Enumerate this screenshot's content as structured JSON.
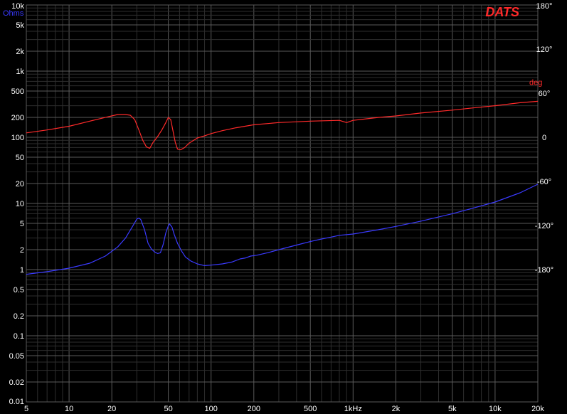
{
  "chart_data": {
    "type": "line",
    "logo": "DATS",
    "colors": {
      "background": "#000000",
      "grid_major": "#5a5a5a",
      "grid_minor": "#2e2e2e",
      "impedance": "#3a3aff",
      "phase": "#ff2a2a",
      "ohms_label": "#3a3aff",
      "deg_label": "#ff2a2a",
      "tick_text": "#ffffff"
    },
    "x_axis": {
      "scale": "log",
      "range": [
        5,
        20000
      ],
      "ticks": [
        {
          "value": 5,
          "label": "5"
        },
        {
          "value": 10,
          "label": "10"
        },
        {
          "value": 20,
          "label": "20"
        },
        {
          "value": 50,
          "label": "50"
        },
        {
          "value": 100,
          "label": "100"
        },
        {
          "value": 200,
          "label": "200"
        },
        {
          "value": 500,
          "label": "500"
        },
        {
          "value": 1000,
          "label": "1kHz"
        },
        {
          "value": 2000,
          "label": "2k"
        },
        {
          "value": 5000,
          "label": "5k"
        },
        {
          "value": 10000,
          "label": "10k"
        },
        {
          "value": 20000,
          "label": "20k"
        }
      ]
    },
    "y_left": {
      "scale": "log",
      "unit": "Ohms",
      "range": [
        0.01,
        10000
      ],
      "ticks": [
        {
          "value": 10000,
          "label": "10k"
        },
        {
          "value": 5000,
          "label": "5k"
        },
        {
          "value": 2000,
          "label": "2k"
        },
        {
          "value": 1000,
          "label": "1k"
        },
        {
          "value": 500,
          "label": "500"
        },
        {
          "value": 200,
          "label": "200"
        },
        {
          "value": 100,
          "label": "100"
        },
        {
          "value": 50,
          "label": "50"
        },
        {
          "value": 20,
          "label": "20"
        },
        {
          "value": 10,
          "label": "10"
        },
        {
          "value": 5,
          "label": "5"
        },
        {
          "value": 2,
          "label": "2"
        },
        {
          "value": 1,
          "label": "1"
        },
        {
          "value": 0.5,
          "label": "0.5"
        },
        {
          "value": 0.2,
          "label": "0.2"
        },
        {
          "value": 0.1,
          "label": "0.1"
        },
        {
          "value": 0.05,
          "label": "0.05"
        },
        {
          "value": 0.02,
          "label": "0.02"
        },
        {
          "value": 0.01,
          "label": "0.01"
        }
      ]
    },
    "y_right": {
      "scale": "linear",
      "unit": "deg",
      "range": [
        -360,
        180
      ],
      "ticks": [
        {
          "value": 180,
          "label": "180°"
        },
        {
          "value": 120,
          "label": "120°"
        },
        {
          "value": 60,
          "label": "60°"
        },
        {
          "value": 0,
          "label": "0"
        },
        {
          "value": -60,
          "label": "-60°"
        },
        {
          "value": -120,
          "label": "-120°"
        },
        {
          "value": -180,
          "label": "-180°"
        }
      ]
    },
    "series": [
      {
        "axis": "left",
        "color": "#3a3aff",
        "points": [
          [
            5,
            0.85
          ],
          [
            7,
            0.93
          ],
          [
            10,
            1.05
          ],
          [
            14,
            1.25
          ],
          [
            18,
            1.6
          ],
          [
            22,
            2.2
          ],
          [
            25,
            3.0
          ],
          [
            28,
            4.5
          ],
          [
            30,
            5.8
          ],
          [
            31,
            6.0
          ],
          [
            32,
            5.7
          ],
          [
            34,
            4.0
          ],
          [
            36,
            2.5
          ],
          [
            38,
            2.05
          ],
          [
            40,
            1.85
          ],
          [
            42,
            1.75
          ],
          [
            44,
            1.8
          ],
          [
            46,
            2.4
          ],
          [
            48,
            3.6
          ],
          [
            50,
            4.6
          ],
          [
            51,
            4.9
          ],
          [
            53,
            4.4
          ],
          [
            55,
            3.4
          ],
          [
            58,
            2.5
          ],
          [
            62,
            1.9
          ],
          [
            66,
            1.55
          ],
          [
            72,
            1.35
          ],
          [
            80,
            1.22
          ],
          [
            90,
            1.15
          ],
          [
            100,
            1.17
          ],
          [
            120,
            1.22
          ],
          [
            140,
            1.3
          ],
          [
            160,
            1.45
          ],
          [
            175,
            1.5
          ],
          [
            190,
            1.6
          ],
          [
            210,
            1.65
          ],
          [
            250,
            1.8
          ],
          [
            300,
            2.0
          ],
          [
            400,
            2.35
          ],
          [
            500,
            2.65
          ],
          [
            600,
            2.9
          ],
          [
            700,
            3.1
          ],
          [
            800,
            3.3
          ],
          [
            1000,
            3.45
          ],
          [
            1500,
            4.0
          ],
          [
            2000,
            4.5
          ],
          [
            3000,
            5.4
          ],
          [
            5000,
            7.0
          ],
          [
            7000,
            8.5
          ],
          [
            10000,
            10.5
          ],
          [
            15000,
            14.5
          ],
          [
            20000,
            19.5
          ]
        ]
      },
      {
        "axis": "right",
        "color": "#ff2a2a",
        "points": [
          [
            5,
            6
          ],
          [
            7,
            10
          ],
          [
            10,
            15
          ],
          [
            14,
            22
          ],
          [
            18,
            27
          ],
          [
            22,
            31
          ],
          [
            25,
            31
          ],
          [
            27,
            30
          ],
          [
            29,
            24
          ],
          [
            31,
            10
          ],
          [
            33,
            -4
          ],
          [
            35,
            -13
          ],
          [
            37,
            -15
          ],
          [
            39,
            -7
          ],
          [
            42,
            1
          ],
          [
            45,
            10
          ],
          [
            48,
            20
          ],
          [
            50,
            27
          ],
          [
            52,
            24
          ],
          [
            54,
            8
          ],
          [
            56,
            -7
          ],
          [
            58,
            -16
          ],
          [
            61,
            -17
          ],
          [
            65,
            -14
          ],
          [
            70,
            -8
          ],
          [
            80,
            -1
          ],
          [
            90,
            2
          ],
          [
            100,
            5
          ],
          [
            120,
            9
          ],
          [
            150,
            13
          ],
          [
            200,
            17
          ],
          [
            300,
            20
          ],
          [
            500,
            22
          ],
          [
            800,
            23
          ],
          [
            900,
            20
          ],
          [
            1000,
            23
          ],
          [
            1500,
            27
          ],
          [
            2000,
            29
          ],
          [
            3000,
            33
          ],
          [
            5000,
            37
          ],
          [
            7000,
            40
          ],
          [
            10000,
            43
          ],
          [
            15000,
            47
          ],
          [
            20000,
            49
          ]
        ]
      }
    ]
  }
}
